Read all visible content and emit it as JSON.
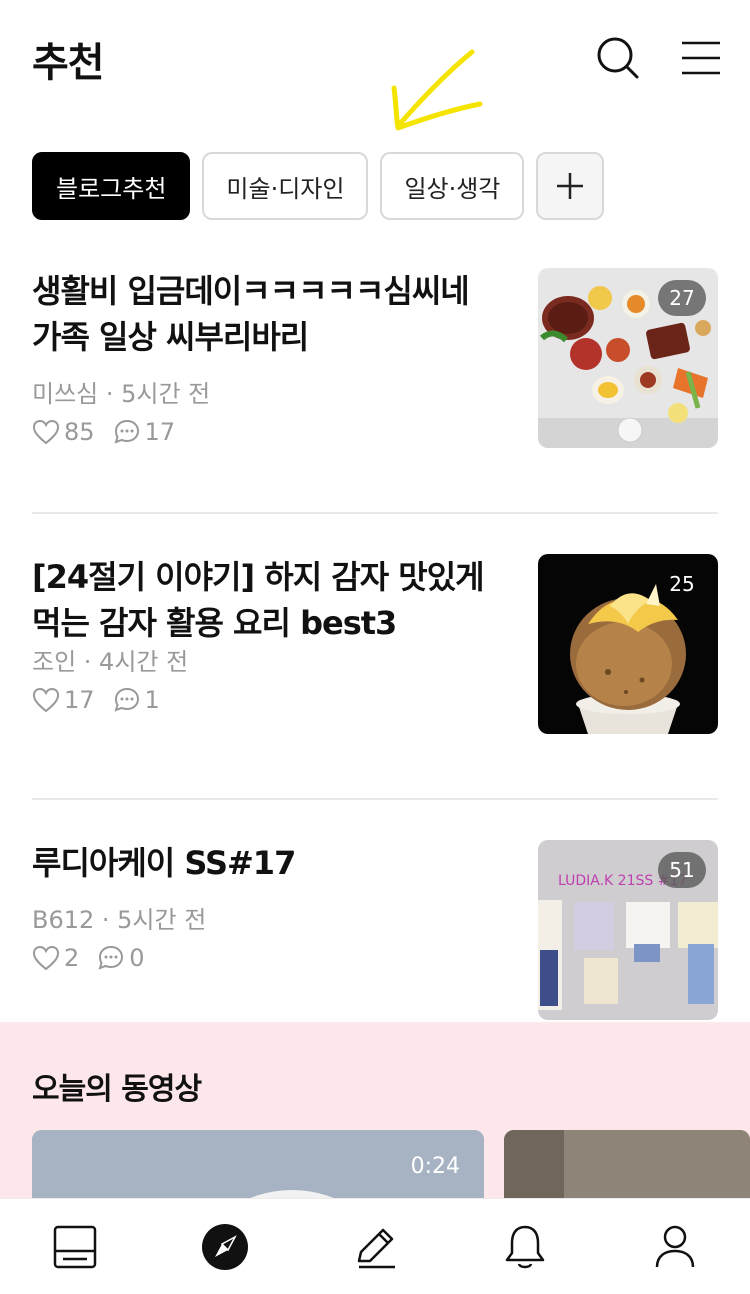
{
  "header": {
    "title": "추천",
    "search_icon": "search-icon",
    "menu_icon": "menu-icon"
  },
  "chips": [
    {
      "label": "블로그추천",
      "active": true
    },
    {
      "label": "미술·디자인",
      "active": false
    },
    {
      "label": "일상·생각",
      "active": false
    }
  ],
  "add_chip_icon": "plus-icon",
  "posts": [
    {
      "title": "생활비 입금데이ㅋㅋㅋㅋㅋ심씨네 가족 일상 씨부리바리",
      "meta": "미쓰심 · 5시간 전",
      "likes": "85",
      "comments": "17",
      "image_count": "27"
    },
    {
      "title": "[24절기 이야기] 하지 감자 맛있게 먹는 감자 활용 요리 best3",
      "meta": "조인 · 4시간 전",
      "likes": "17",
      "comments": "1",
      "image_count": "25"
    },
    {
      "title": "루디아케이 SS#17",
      "meta": "B612 · 5시간 전",
      "likes": "2",
      "comments": "0",
      "image_count": "51",
      "thumb_text": "LUDIA.K 21SS #17"
    }
  ],
  "videos": {
    "title": "오늘의 동영상",
    "items": [
      {
        "duration": "0:24"
      }
    ]
  },
  "tabbar": {
    "items": [
      "feed-icon",
      "compass-icon",
      "pencil-icon",
      "bell-icon",
      "profile-icon"
    ]
  },
  "colors": {
    "accent": "#000000",
    "video_section_bg": "#fde7ea",
    "annotation": "#f5e400"
  }
}
